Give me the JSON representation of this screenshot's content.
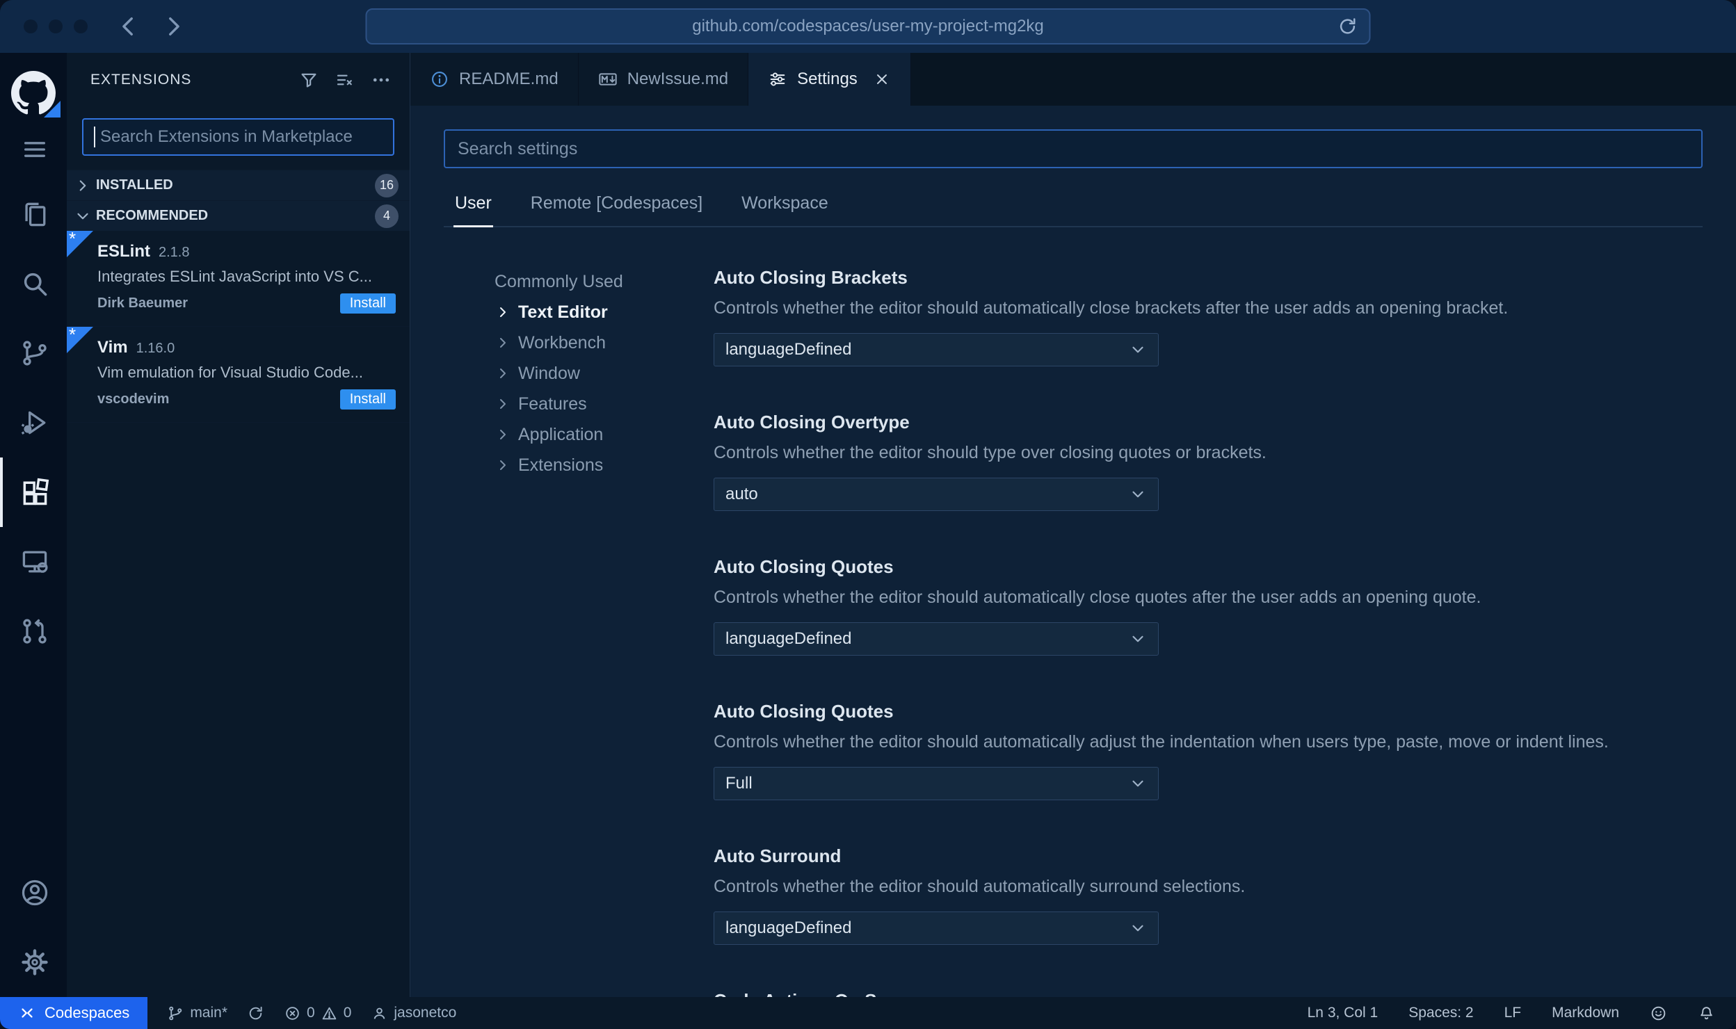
{
  "colors": {
    "accent_blue": "#1d63ed",
    "install_blue": "#2e8fef",
    "focus_border": "#3273dd",
    "flag_blue": "#2d7ff0"
  },
  "browser": {
    "url": "github.com/codespaces/user-my-project-mg2kg"
  },
  "activity_bar": {
    "items": [
      "menu",
      "explorer",
      "search",
      "source-control",
      "run-debug",
      "extensions",
      "remote-explorer",
      "pull-requests"
    ],
    "active": "extensions",
    "bottom_items": [
      "account",
      "settings-gear"
    ]
  },
  "extensions_panel": {
    "title": "EXTENSIONS",
    "search_placeholder": "Search Extensions in Marketplace",
    "sections": [
      {
        "label": "INSTALLED",
        "count": "16"
      },
      {
        "label": "RECOMMENDED",
        "count": "4"
      }
    ],
    "items": [
      {
        "name": "ESLint",
        "version": "2.1.8",
        "description": "Integrates ESLint JavaScript into VS C...",
        "publisher": "Dirk Baeumer",
        "action": "Install"
      },
      {
        "name": "Vim",
        "version": "1.16.0",
        "description": "Vim emulation for Visual Studio Code...",
        "publisher": "vscodevim",
        "action": "Install"
      }
    ]
  },
  "editor_tabs": [
    {
      "label": "README.md"
    },
    {
      "label": "NewIssue.md"
    },
    {
      "label": "Settings"
    }
  ],
  "settings_editor": {
    "search_placeholder": "Search settings",
    "scopes": [
      {
        "label": "User"
      },
      {
        "label": "Remote [Codespaces]"
      },
      {
        "label": "Workspace"
      }
    ],
    "active_scope": "User",
    "toc": [
      {
        "label": "Commonly Used"
      },
      {
        "label": "Text Editor"
      },
      {
        "label": "Workbench"
      },
      {
        "label": "Window"
      },
      {
        "label": "Features"
      },
      {
        "label": "Application"
      },
      {
        "label": "Extensions"
      }
    ],
    "active_toc": "Text Editor",
    "items": [
      {
        "title": "Auto Closing Brackets",
        "description": "Controls whether the editor should automatically close brackets after the user adds an opening bracket.",
        "value": "languageDefined"
      },
      {
        "title": "Auto Closing Overtype",
        "description": "Controls whether the editor should type over closing quotes or brackets.",
        "value": "auto"
      },
      {
        "title": "Auto Closing Quotes",
        "description": "Controls whether the editor should automatically close quotes after the user adds an opening quote.",
        "value": "languageDefined"
      },
      {
        "title": "Auto Closing Quotes",
        "description": "Controls whether the editor should automatically adjust the indentation when users type, paste, move or indent lines.",
        "value": "Full"
      },
      {
        "title": "Auto Surround",
        "description": "Controls whether the editor should automatically surround selections.",
        "value": "languageDefined"
      },
      {
        "title": "Code Actions On Save",
        "description": "",
        "value": ""
      }
    ]
  },
  "status_bar": {
    "codespaces_label": "Codespaces",
    "branch": "main*",
    "errors": "0",
    "warnings": "0",
    "user": "jasonetco",
    "cursor": "Ln 3, Col 1",
    "indentation": "Spaces: 2",
    "eol": "LF",
    "language": "Markdown"
  }
}
